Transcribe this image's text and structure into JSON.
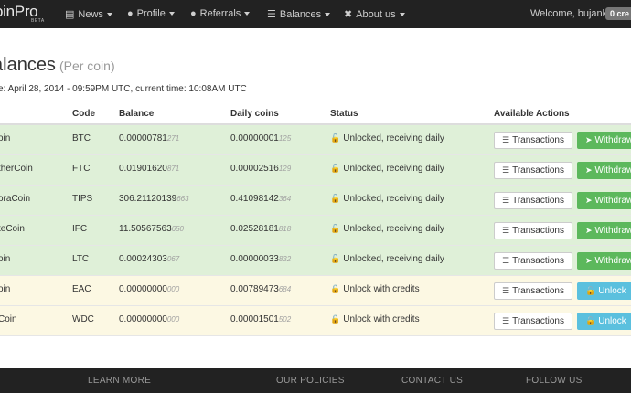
{
  "navbar": {
    "brand": "oinPro",
    "brand_beta": "BETA",
    "items": [
      {
        "label": "News",
        "icon": "newspaper-icon"
      },
      {
        "label": "Profile",
        "icon": "user-icon"
      },
      {
        "label": "Referrals",
        "icon": "users-icon"
      },
      {
        "label": "Balances",
        "icon": "list-icon"
      },
      {
        "label": "About us",
        "icon": "wrench-icon"
      }
    ],
    "welcome": "Welcome, bujank!",
    "credits": "0 cre"
  },
  "page": {
    "title": "alances",
    "subtitle": "(Per coin)",
    "info": "e: April 28, 2014 - 09:59PM UTC, current time: 10:08AM UTC"
  },
  "table": {
    "headers": {
      "code": "Code",
      "balance": "Balance",
      "daily": "Daily coins",
      "status": "Status",
      "actions": "Available Actions"
    },
    "rows": [
      {
        "name": "oin",
        "code": "BTC",
        "balance": "0.00000781",
        "balance_dim": "271",
        "daily": "0.00000001",
        "daily_dim": "125",
        "status": "Unlocked, receiving daily",
        "locked": false,
        "action": "Withdraw"
      },
      {
        "name": "therCoin",
        "code": "FTC",
        "balance": "0.01901620",
        "balance_dim": "871",
        "daily": "0.00002516",
        "daily_dim": "129",
        "status": "Unlocked, receiving daily",
        "locked": false,
        "action": "Withdraw"
      },
      {
        "name": "oraCoin",
        "code": "TIPS",
        "balance": "306.21120139",
        "balance_dim": "663",
        "daily": "0.41098142",
        "daily_dim": "364",
        "status": "Unlocked, receiving daily",
        "locked": false,
        "action": "Withdraw"
      },
      {
        "name": "teCoin",
        "code": "IFC",
        "balance": "11.50567563",
        "balance_dim": "650",
        "daily": "0.02528181",
        "daily_dim": "818",
        "status": "Unlocked, receiving daily",
        "locked": false,
        "action": "Withdraw"
      },
      {
        "name": "oin",
        "code": "LTC",
        "balance": "0.00024303",
        "balance_dim": "067",
        "daily": "0.00000033",
        "daily_dim": "832",
        "status": "Unlocked, receiving daily",
        "locked": false,
        "action": "Withdraw"
      },
      {
        "name": "oin",
        "code": "EAC",
        "balance": "0.00000000",
        "balance_dim": "000",
        "daily": "0.00789473",
        "daily_dim": "684",
        "status": "Unlock with credits",
        "locked": true,
        "action": "Unlock"
      },
      {
        "name": "Coin",
        "code": "WDC",
        "balance": "0.00000000",
        "balance_dim": "000",
        "daily": "0.00001501",
        "daily_dim": "502",
        "status": "Unlock with credits",
        "locked": true,
        "action": "Unlock"
      }
    ],
    "transactions_label": "Transactions"
  },
  "footer": {
    "links": [
      "LEARN MORE",
      "OUR POLICIES",
      "CONTACT US",
      "FOLLOW US"
    ]
  },
  "colors": {
    "navbar": "#222222",
    "unlocked_row": "#dff0d8",
    "locked_row": "#fcf8e3",
    "withdraw_button": "#5cb85c",
    "unlock_button": "#5bc0de"
  }
}
